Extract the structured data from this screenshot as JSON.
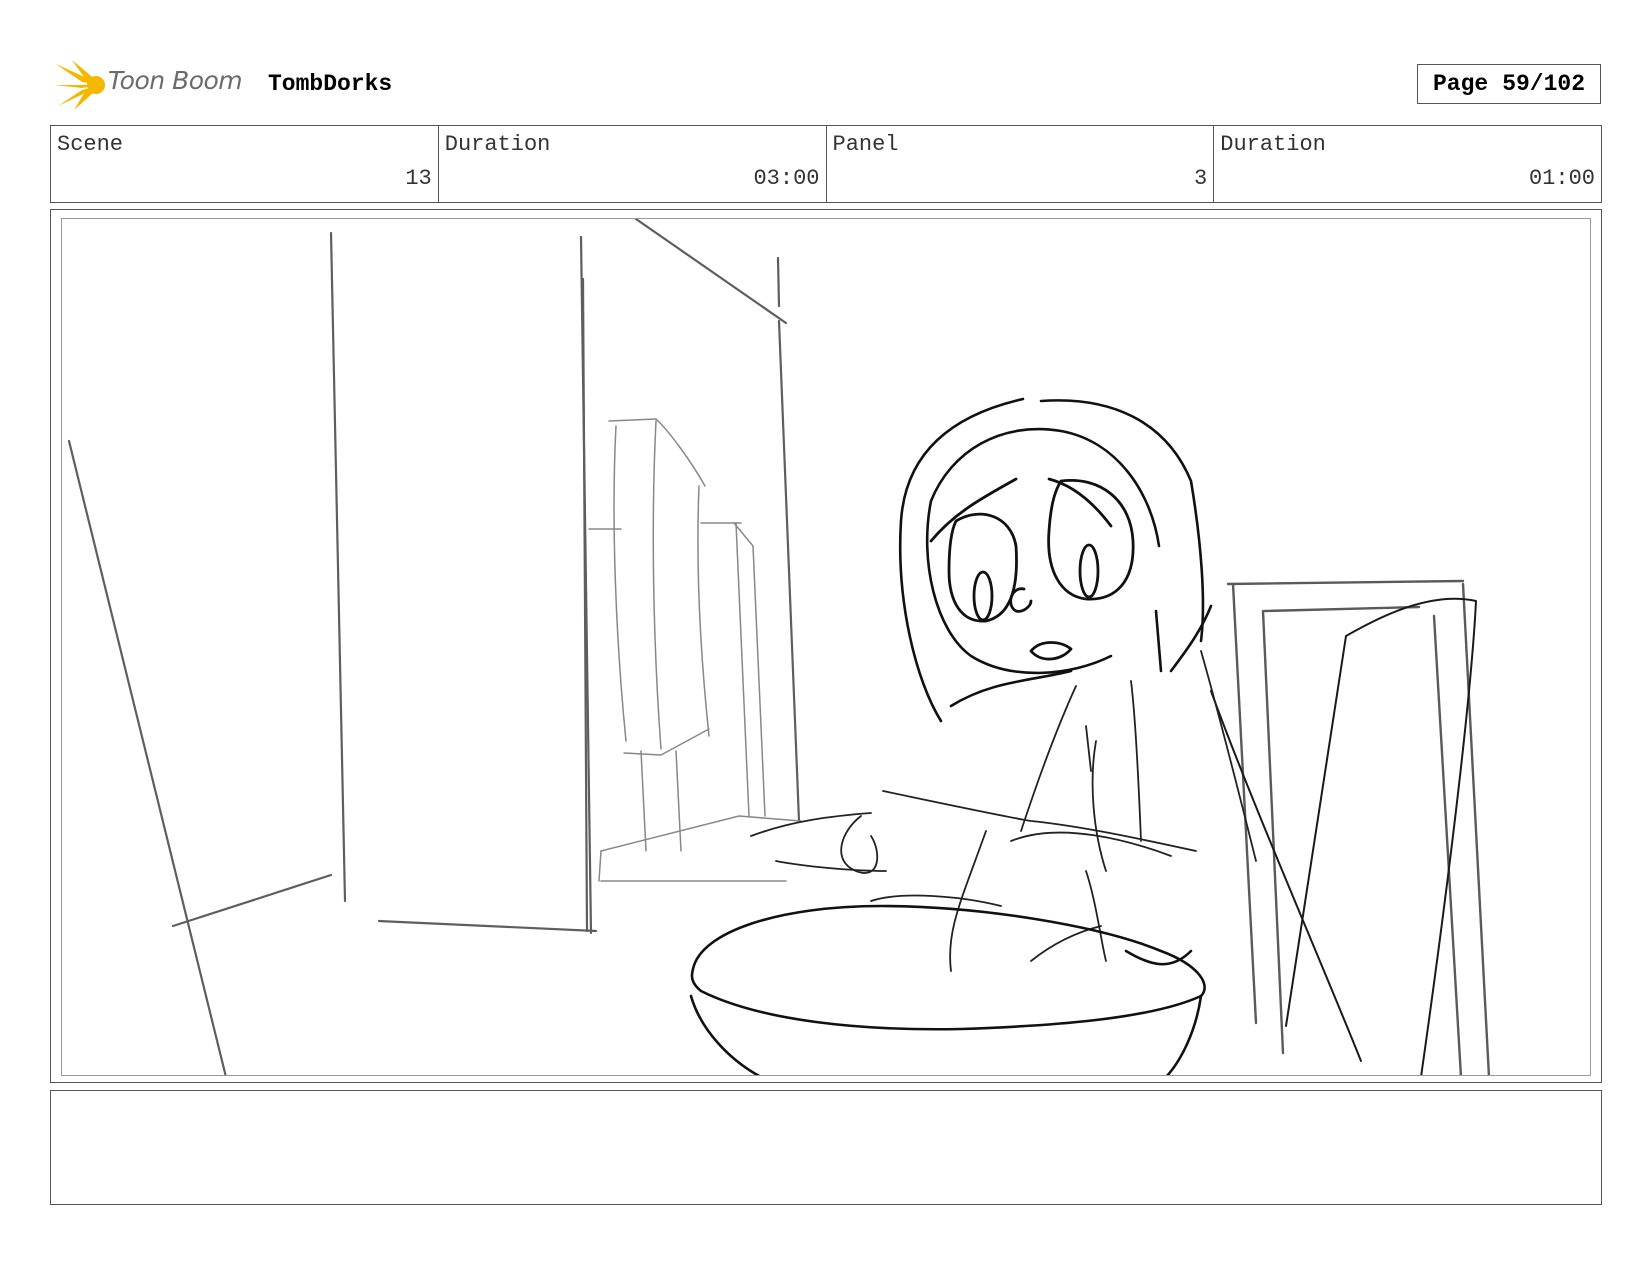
{
  "header": {
    "logo_text": "Toon Boom",
    "project_title": "TombDorks",
    "page_label": "Page",
    "page_number": "59/102"
  },
  "fields": [
    {
      "label": "Scene",
      "value": "13"
    },
    {
      "label": "Duration",
      "value": "03:00"
    },
    {
      "label": "Panel",
      "value": "3"
    },
    {
      "label": "Duration",
      "value": "01:00"
    }
  ],
  "colors": {
    "logo_burst": "#f5b800",
    "frame_border": "#555555",
    "sketch_stroke": "#1a1a1a",
    "sketch_light": "#6a6a6a"
  },
  "notes": {
    "text": ""
  }
}
